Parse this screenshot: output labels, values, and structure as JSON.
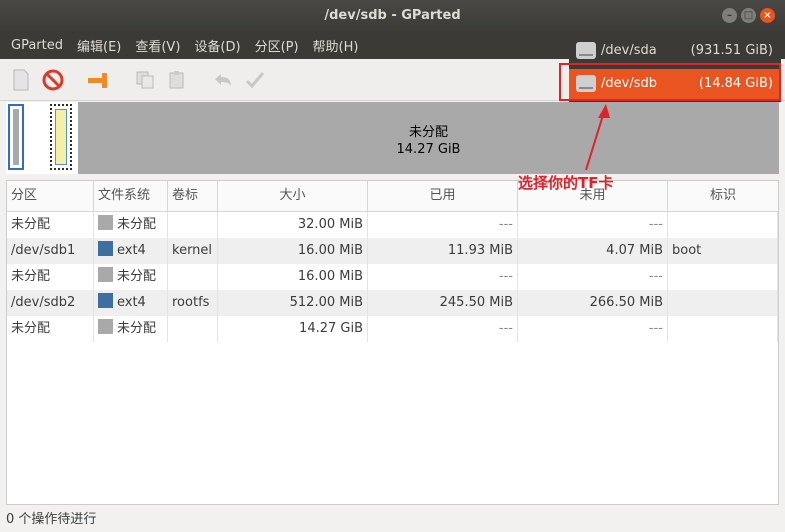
{
  "window": {
    "title": "/dev/sdb - GParted"
  },
  "menu": [
    "GParted",
    "编辑(E)",
    "查看(V)",
    "设备(D)",
    "分区(P)",
    "帮助(H)"
  ],
  "diskmap": {
    "unalloc_label": "未分配",
    "unalloc_size": "14.27 GiB"
  },
  "columns": [
    "分区",
    "文件系统",
    "卷标",
    "大小",
    "已用",
    "未用",
    "标识"
  ],
  "rows": [
    {
      "part": "未分配",
      "fs": "未分配",
      "fs_color": "#a9a9a9",
      "label": "",
      "size": "32.00 MiB",
      "used": "---",
      "unused": "---",
      "flags": ""
    },
    {
      "part": "/dev/sdb1",
      "fs": "ext4",
      "fs_color": "#3f6f9e",
      "label": "kernel",
      "size": "16.00 MiB",
      "used": "11.93 MiB",
      "unused": "4.07 MiB",
      "flags": "boot"
    },
    {
      "part": "未分配",
      "fs": "未分配",
      "fs_color": "#a9a9a9",
      "label": "",
      "size": "16.00 MiB",
      "used": "---",
      "unused": "---",
      "flags": ""
    },
    {
      "part": "/dev/sdb2",
      "fs": "ext4",
      "fs_color": "#3f6f9e",
      "label": "rootfs",
      "size": "512.00 MiB",
      "used": "245.50 MiB",
      "unused": "266.50 MiB",
      "flags": ""
    },
    {
      "part": "未分配",
      "fs": "未分配",
      "fs_color": "#a9a9a9",
      "label": "",
      "size": "14.27 GiB",
      "used": "---",
      "unused": "---",
      "flags": ""
    }
  ],
  "devices": [
    {
      "name": "/dev/sda",
      "size": "(931.51 GiB)"
    },
    {
      "name": "/dev/sdb",
      "size": "(14.84 GiB)"
    }
  ],
  "annotation": "选择你的TF卡",
  "status": "0 个操作待进行",
  "colors": {
    "accent": "#e95420",
    "highlight": "#e0222a"
  }
}
